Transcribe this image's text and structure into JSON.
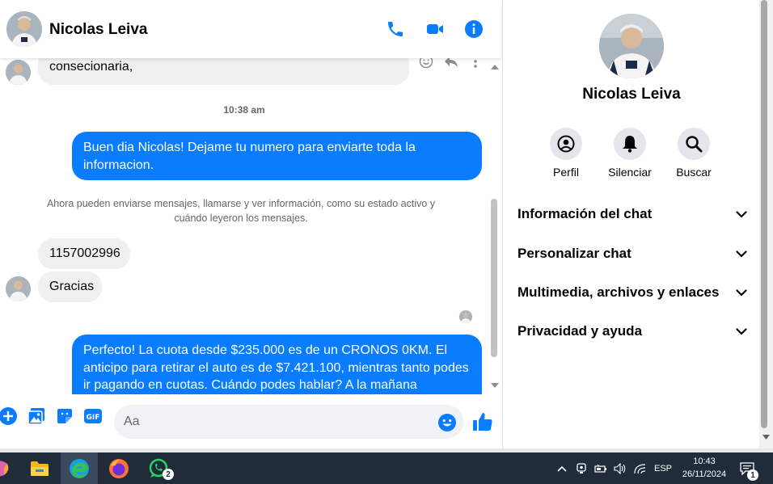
{
  "header": {
    "contact_name": "Nicolas Leiva"
  },
  "messages": {
    "top_partial_text": "consecionaria,",
    "time_1": "10:38 am",
    "out_1": "Buen dia Nicolas! Dejame tu numero para enviarte toda la informacion.",
    "notice": "Ahora pueden enviarse mensajes, llamarse y ver información, como su estado activo y cuándo leyeron los mensajes.",
    "in_phone": "1157002996",
    "in_thanks": "Gracias",
    "out_2": "Perfecto! La cuota desde $235.000 es de un CRONOS 0KM. El anticipo para retirar el auto es de $7.421.100, mientras tanto podes ir pagando en cuotas. Cuándo podes hablar? A la mañana"
  },
  "composer": {
    "placeholder": "Aa"
  },
  "panel": {
    "name": "Nicolas Leiva",
    "actions": [
      {
        "label": "Perfil"
      },
      {
        "label": "Silenciar"
      },
      {
        "label": "Buscar"
      }
    ],
    "sections": [
      {
        "label": "Información del chat"
      },
      {
        "label": "Personalizar chat"
      },
      {
        "label": "Multimedia, archivos y enlaces"
      },
      {
        "label": "Privacidad y ayuda"
      }
    ]
  },
  "taskbar": {
    "whatsapp_badge": "2",
    "language": "ESP",
    "time": "10:43",
    "date": "26/11/2024",
    "notifications": "1"
  },
  "colors": {
    "accent": "#0a7cff",
    "incoming_bubble": "#f0f0f0",
    "taskbar": "#202c3a"
  }
}
